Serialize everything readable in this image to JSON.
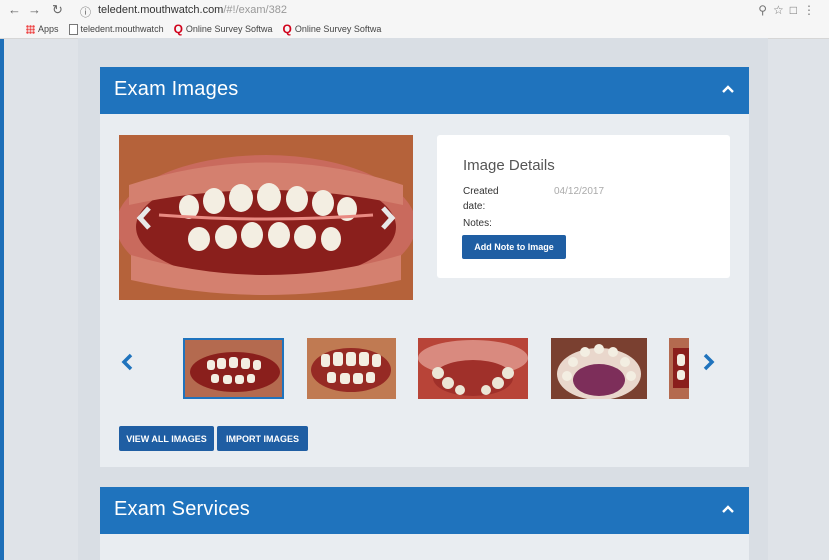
{
  "browser": {
    "url_host": "teledent.mouthwatch.com",
    "url_path": "/#!/exam/382",
    "bookmarks": [
      "Apps",
      "teledent.mouthwatch",
      "Online Survey Softwa",
      "Online Survey Softwa"
    ]
  },
  "exam_images": {
    "title": "Exam Images",
    "details": {
      "title": "Image Details",
      "created_label_1": "Created",
      "created_label_2": "date:",
      "created_value": "04/12/2017",
      "notes_label": "Notes:",
      "add_note_label": "Add Note to Image"
    },
    "view_all_label": "VIEW ALL IMAGES",
    "import_label": "IMPORT IMAGES"
  },
  "exam_services": {
    "title": "Exam Services"
  },
  "colors": {
    "header_blue": "#1f73bd",
    "button_blue": "#1f5ea3"
  }
}
